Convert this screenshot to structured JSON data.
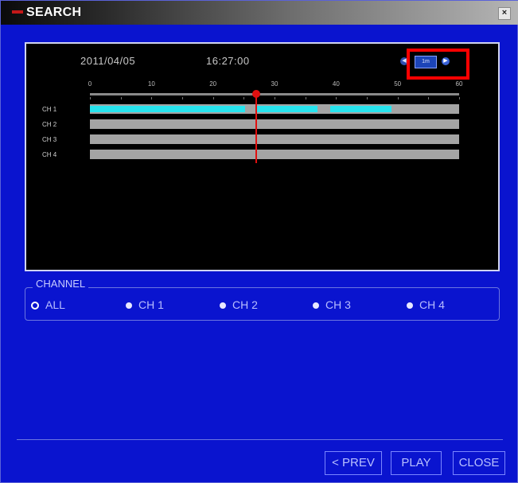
{
  "window": {
    "title": "SEARCH",
    "close_glyph": "×"
  },
  "timeline": {
    "date": "2011/04/05",
    "time": "16:27:00",
    "controls": {
      "prev_icon": "prev-circle-icon",
      "zoom_label": "1m",
      "next_icon": "next-circle-icon"
    },
    "scale_labels": [
      "0",
      "10",
      "20",
      "30",
      "40",
      "50",
      "60"
    ],
    "channels": [
      {
        "label": "CH 1",
        "recorded_minutes": [
          [
            0,
            25.2
          ],
          [
            27,
            37
          ],
          [
            39,
            49
          ]
        ]
      },
      {
        "label": "CH 2",
        "recorded_minutes": []
      },
      {
        "label": "CH 3",
        "recorded_minutes": []
      },
      {
        "label": "CH 4",
        "recorded_minutes": []
      }
    ],
    "cursor_minute": 27,
    "colors": {
      "recorded": "#27e4ee",
      "empty": "#a4a4a4",
      "cursor": "#e01010"
    }
  },
  "channel_group": {
    "legend": "CHANNEL",
    "options": [
      {
        "label": "ALL",
        "selected": true
      },
      {
        "label": "CH 1",
        "selected": false
      },
      {
        "label": "CH 2",
        "selected": false
      },
      {
        "label": "CH 3",
        "selected": false
      },
      {
        "label": "CH 4",
        "selected": false
      }
    ]
  },
  "buttons": {
    "prev": "< PREV",
    "play": "PLAY",
    "close": "CLOSE"
  }
}
